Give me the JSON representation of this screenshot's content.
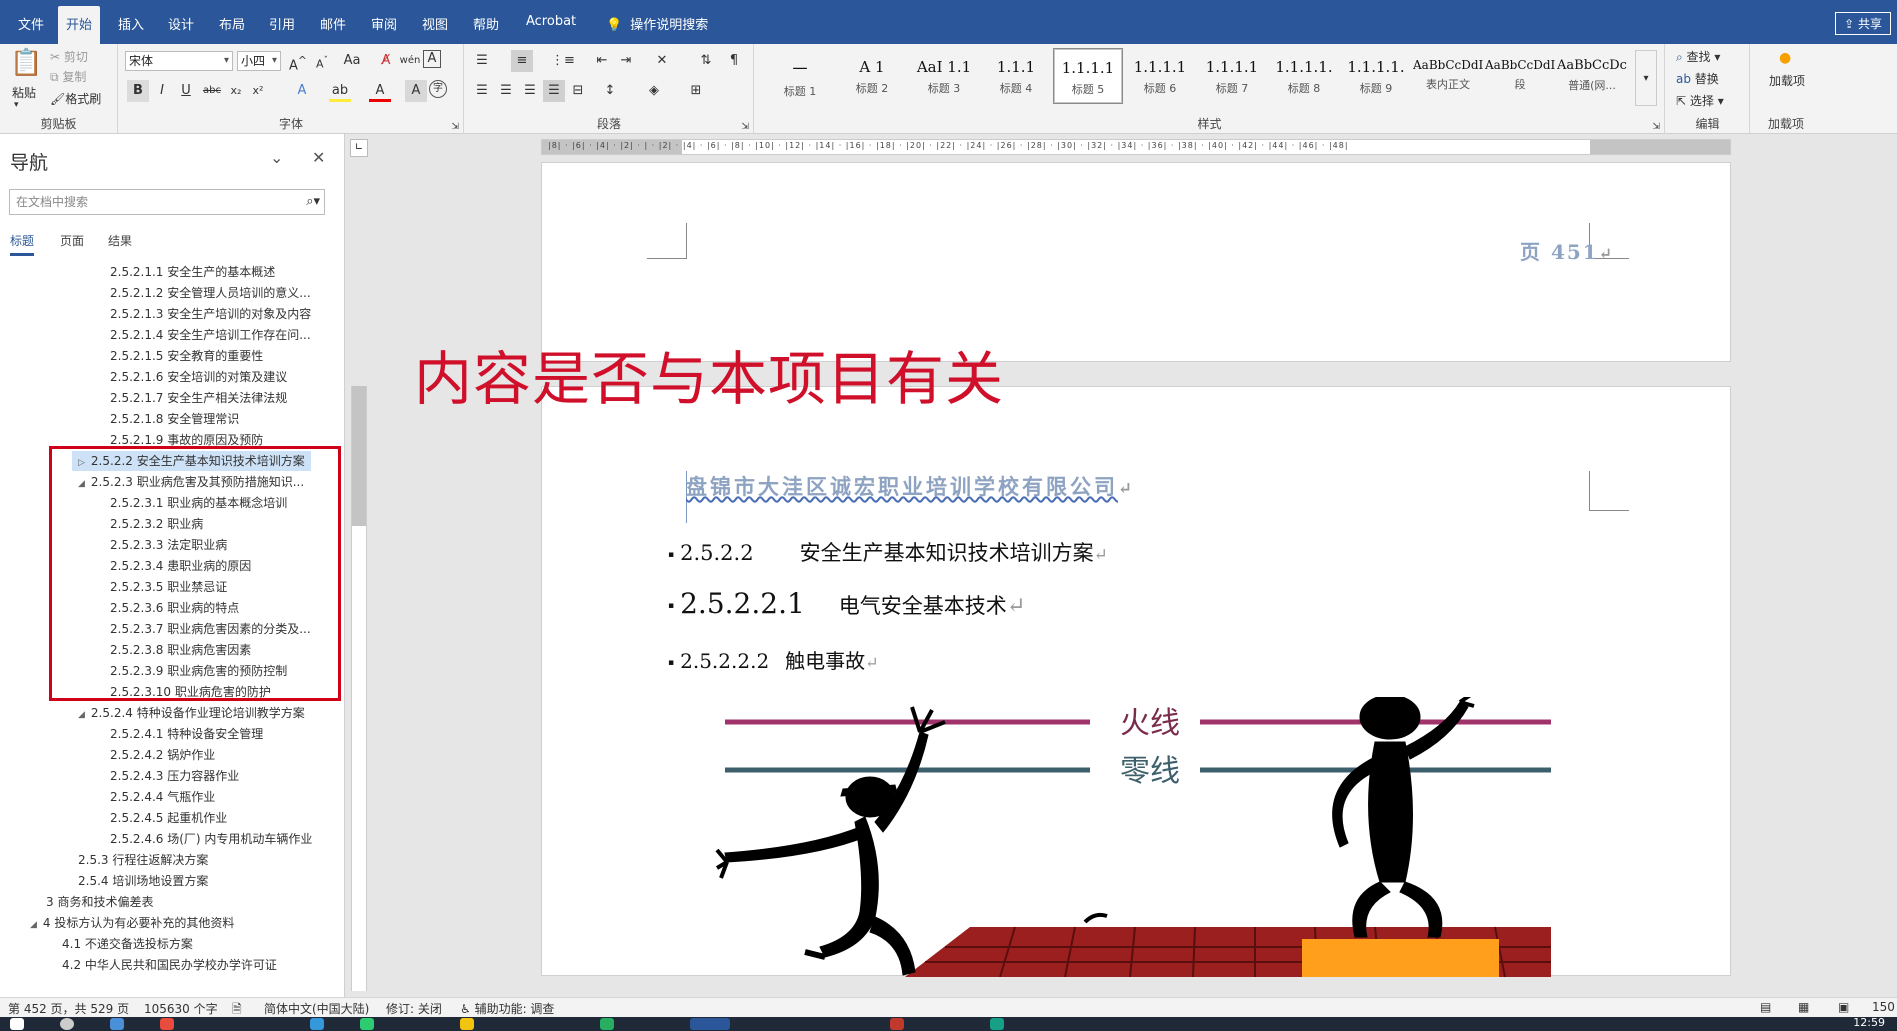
{
  "menubar": {
    "tabs": [
      "文件",
      "开始",
      "插入",
      "设计",
      "布局",
      "引用",
      "邮件",
      "审阅",
      "视图",
      "帮助",
      "Acrobat",
      "操作说明搜索"
    ],
    "active_tab": "开始",
    "share": "共享"
  },
  "ribbon": {
    "clipboard": {
      "paste": "粘贴",
      "cut": "剪切",
      "copy": "复制",
      "format_painter": "格式刷",
      "label": "剪贴板"
    },
    "font": {
      "name": "宋体",
      "size": "小四",
      "label": "字体"
    },
    "paragraph": {
      "label": "段落"
    },
    "styles": {
      "label": "样式",
      "items": [
        {
          "sample": "一",
          "name": "标题 1"
        },
        {
          "sample": "A 1",
          "name": "标题 2"
        },
        {
          "sample": "AaI 1.1",
          "name": "标题 3"
        },
        {
          "sample": "1.1.1",
          "name": "标题 4"
        },
        {
          "sample": "1.1.1.1",
          "name": "标题 5"
        },
        {
          "sample": "1.1.1.1",
          "name": "标题 6"
        },
        {
          "sample": "1.1.1.1",
          "name": "标题 7"
        },
        {
          "sample": "1.1.1.1.",
          "name": "标题 8"
        },
        {
          "sample": "1.1.1.1.",
          "name": "标题 9"
        },
        {
          "sample": "AaBbCcDdI",
          "name": "表内正文"
        },
        {
          "sample": "AaBbCcDdI",
          "name": "段"
        },
        {
          "sample": "AaBbCcDc",
          "name": "普通(网..."
        }
      ],
      "selected": "标题 5"
    },
    "editing": {
      "find": "查找",
      "replace": "替换",
      "select": "选择",
      "label": "编辑"
    },
    "addins": {
      "button": "加载项",
      "label": "加载项"
    }
  },
  "nav": {
    "title": "导航",
    "search_placeholder": "在文档中搜索",
    "tabs": [
      "标题",
      "页面",
      "结果"
    ],
    "items": [
      {
        "text": "2.5.2.1.1 安全生产的基本概述",
        "level": 5
      },
      {
        "text": "2.5.2.1.2 安全管理人员培训的意义...",
        "level": 5
      },
      {
        "text": "2.5.2.1.3 安全生产培训的对象及内容",
        "level": 5
      },
      {
        "text": "2.5.2.1.4 安全生产培训工作存在问...",
        "level": 5
      },
      {
        "text": "2.5.2.1.5 安全教育的重要性",
        "level": 5
      },
      {
        "text": "2.5.2.1.6 安全培训的对策及建议",
        "level": 5
      },
      {
        "text": "2.5.2.1.7 安全生产相关法律法规",
        "level": 5
      },
      {
        "text": "2.5.2.1.8 安全管理常识",
        "level": 5
      },
      {
        "text": "2.5.2.1.9 事故的原因及预防",
        "level": 5
      },
      {
        "text": "2.5.2.2 安全生产基本知识技术培训方案",
        "level": 4,
        "current": true,
        "arrow": "▷"
      },
      {
        "text": "2.5.2.3 职业病危害及其预防措施知识...",
        "level": 4,
        "arrow": "◢"
      },
      {
        "text": "2.5.2.3.1  职业病的基本概念培训",
        "level": 5
      },
      {
        "text": "2.5.2.3.2 职业病",
        "level": 5
      },
      {
        "text": "2.5.2.3.3 法定职业病",
        "level": 5
      },
      {
        "text": "2.5.2.3.4 患职业病的原因",
        "level": 5
      },
      {
        "text": "2.5.2.3.5 职业禁忌证",
        "level": 5
      },
      {
        "text": "2.5.2.3.6 职业病的特点",
        "level": 5
      },
      {
        "text": "2.5.2.3.7  职业病危害因素的分类及...",
        "level": 5
      },
      {
        "text": "2.5.2.3.8 职业病危害因素",
        "level": 5
      },
      {
        "text": "2.5.2.3.9 职业病危害的预防控制",
        "level": 5
      },
      {
        "text": "2.5.2.3.10 职业病危害的防护",
        "level": 5
      },
      {
        "text": "2.5.2.4 特种设备作业理论培训教学方案",
        "level": 4,
        "arrow": "◢"
      },
      {
        "text": "2.5.2.4.1 特种设备安全管理",
        "level": 5
      },
      {
        "text": "2.5.2.4.2 锅炉作业",
        "level": 5
      },
      {
        "text": "2.5.2.4.3 压力容器作业",
        "level": 5
      },
      {
        "text": "2.5.2.4.4 气瓶作业",
        "level": 5
      },
      {
        "text": "2.5.2.4.5 起重机作业",
        "level": 5
      },
      {
        "text": "2.5.2.4.6 场(厂) 内专用机动车辆作业",
        "level": 5
      },
      {
        "text": "2.5.3 行程往返解决方案",
        "level": 3
      },
      {
        "text": "2.5.4 培训场地设置方案",
        "level": 3
      },
      {
        "text": "3 商务和技术偏差表",
        "level": 1
      },
      {
        "text": "4 投标方认为有必要补充的其他资料",
        "level": 1,
        "arrow": "◢"
      },
      {
        "text": "4.1 不递交备选投标方案",
        "level": 2
      },
      {
        "text": "4.2 中华人民共和国民办学校办学许可证",
        "level": 2
      }
    ]
  },
  "document": {
    "page_number": "页 451",
    "overlay_text": "内容是否与本项目有关",
    "company": "盘锦市大洼区诚宏职业培训学校有限公司",
    "headings": [
      {
        "num": "2.5.2.2",
        "text": "安全生产基本知识技术培训方案"
      },
      {
        "num": "2.5.2.2.1",
        "text": "电气安全基本技术"
      },
      {
        "num": "2.5.2.2.2",
        "text": "触电事故"
      }
    ],
    "illustration": {
      "live_wire": "火线",
      "neutral_wire": "零线"
    }
  },
  "statusbar": {
    "page": "第 452 页，共 529 页",
    "words": "105630 个字",
    "language": "简体中文(中国大陆)",
    "track": "修订: 关闭",
    "accessibility": "辅助功能: 调查",
    "zoom": "150"
  },
  "taskbar": {
    "clock": "12:59"
  },
  "colors": {
    "accent": "#2b579a",
    "overlay_red": "#d0102a",
    "live_wire": "#a0336b",
    "neutral_wire": "#3d5f6b"
  }
}
